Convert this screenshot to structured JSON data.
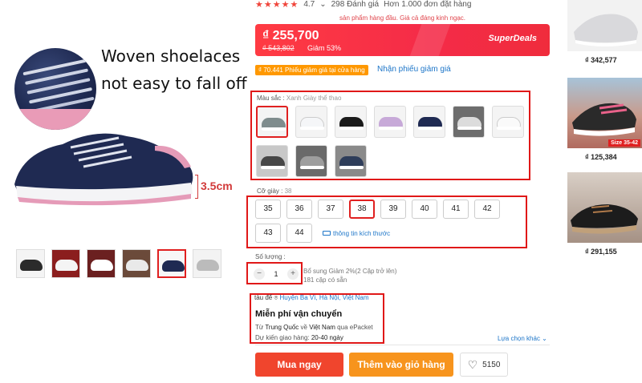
{
  "gallery": {
    "caption_line1": "Woven shoelaces",
    "caption_line2": "not easy to fall off",
    "dimension_label": "3.5cm",
    "thumbnails": [
      {
        "color": "#ffffff",
        "accent": "#2b2b2b"
      },
      {
        "color": "#8b1e1e",
        "accent": "#ffffff"
      },
      {
        "color": "#6b2020",
        "accent": "#f4f4f4"
      },
      {
        "color": "#6b4a3a",
        "accent": "#e9e9e9"
      },
      {
        "color": "#f7f7f7",
        "accent": "#1f2a52"
      },
      {
        "color": "#f3f3f3",
        "accent": "#bbbbbb"
      }
    ]
  },
  "rating": {
    "stars": "★★★★★",
    "score": "4.7",
    "reviews": "298 Đánh giá",
    "orders": "Hơn 1.000 đơn đặt hàng"
  },
  "note": "sản phẩm hàng đầu. Giá cả đáng kinh ngạc.",
  "price": {
    "current": "₫ 255,700",
    "original": "₫ 543,802",
    "discount": "Giảm 53%",
    "badge": "SuperDeals"
  },
  "coupon": {
    "text": "₫ 70.441 Phiếu giảm giá tại cửa hàng",
    "link": "Nhận phiếu giảm giá"
  },
  "color": {
    "label": "Màu sắc : ",
    "value": "Xanh Giày thể thao",
    "swatches": [
      {
        "color": "#7f8c8d"
      },
      {
        "color": "#f5f6f8"
      },
      {
        "color": "#1b1b1b"
      },
      {
        "color": "#c7a9d8"
      },
      {
        "color": "#1f2a52"
      },
      {
        "color": "#6d6d6d"
      },
      {
        "color": "#fafafa"
      },
      {
        "color": "#474747"
      },
      {
        "color": "#9e9e9e"
      },
      {
        "color": "#2e3d5a"
      }
    ]
  },
  "size": {
    "label": "Cỡ giày : ",
    "value": "38",
    "options": [
      "35",
      "36",
      "37",
      "38",
      "39",
      "40",
      "41",
      "42",
      "43",
      "44"
    ],
    "guide": "thông tin kích thước"
  },
  "quantity": {
    "label": "Số lượng :",
    "value": "1",
    "minus": "−",
    "plus": "+",
    "promo": "Bổ sung Giảm 2%(2 Cặp trở lên)",
    "stock": "181 cặp có sẵn"
  },
  "shipping": {
    "from_prefix": "tàu để",
    "from_location": "Huyện Ba Vì, Hà Nội, Việt Nam",
    "title": "Miễn phí vận chuyển",
    "via_1": "Từ ",
    "via_origin": "Trung Quốc",
    "via_2": " về ",
    "via_dest": "Việt Nam",
    "via_3": " qua ePacket",
    "eta_label": "Dự kiến giao hàng: ",
    "eta_value": "20-40 ngày",
    "more": "Lựa chọn khác ⌄"
  },
  "actions": {
    "buy": "Mua ngay",
    "cart": "Thêm vào giỏ hàng",
    "wishlist_count": "5150"
  },
  "recommended": [
    {
      "price": "₫ 342,577"
    },
    {
      "price": "₫ 125,384",
      "badge": "Size 35-42"
    },
    {
      "price": "₫ 291,155"
    }
  ]
}
